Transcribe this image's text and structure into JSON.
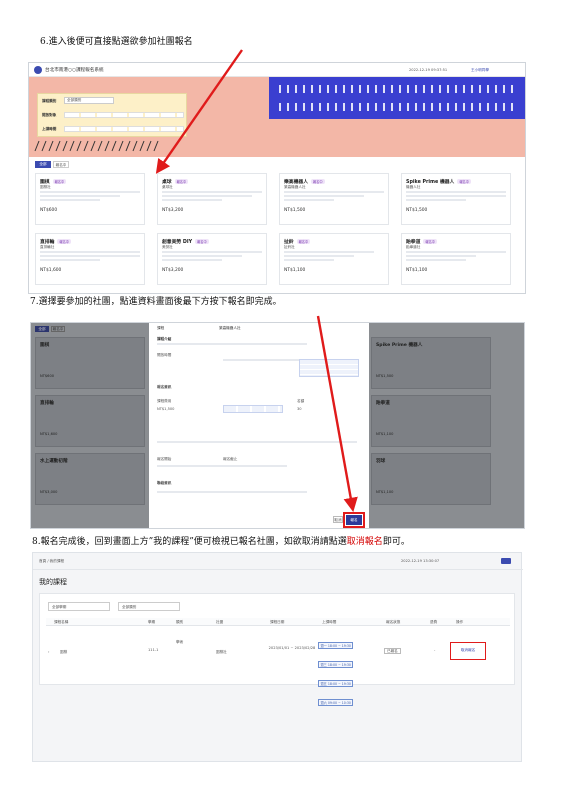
{
  "steps": {
    "step6": "6.進入後便可直接點選欲參加社團報名",
    "step7": "7.選擇要參加的社團，點進資料畫面後最下方按下報名即完成。",
    "step8_prefix": "8.報名完成後，回到畫面上方”我的課程”便可檢視已報名社團，如欲取消請點選",
    "step8_red": "取消報名",
    "step8_suffix": "即可。"
  },
  "shot1": {
    "site_title": "台北市南港○○課程報名系統",
    "date": "2022-12-19 09:37:51",
    "user": "王小明同學",
    "filter_labels": [
      "課程類別",
      "開放對象",
      "上課時間"
    ],
    "filter_select": "全部類別",
    "tab_all": "全部",
    "tab_open": "報名中",
    "cards": [
      {
        "title": "圍棋",
        "badge": "報名中",
        "sub": "圍棋社",
        "price": "NT$600"
      },
      {
        "title": "桌球",
        "badge": "報名中",
        "sub": "桌球社",
        "price": "NT$3,200"
      },
      {
        "title": "樂高機器人",
        "badge": "報名中",
        "sub": "樂高機器人社",
        "price": "NT$1,500"
      },
      {
        "title": "Spike Prime 機器人",
        "badge": "報名中",
        "sub": "機器人社",
        "price": "NT$1,500"
      },
      {
        "title": "直排輪",
        "badge": "報名中",
        "sub": "直排輪社",
        "price": "NT$1,600"
      },
      {
        "title": "創意美勞 DIY",
        "badge": "報名中",
        "sub": "美勞社",
        "price": "NT$3,200"
      },
      {
        "title": "扯鈴",
        "badge": "報名中",
        "sub": "扯鈴社",
        "price": "NT$1,100"
      },
      {
        "title": "跆拳道",
        "badge": "報名中",
        "sub": "跆拳道社",
        "price": "NT$1,100"
      }
    ]
  },
  "shot2": {
    "tab_all": "全部",
    "tab_open": "報名中",
    "left_cards": [
      {
        "title": "圍棋",
        "price": "NT$600"
      },
      {
        "title": "直排輪",
        "price": "NT$1,600"
      },
      {
        "title": "水上運動初階",
        "price": "NT$3,000"
      }
    ],
    "right_cards": [
      {
        "title": "Spike Prime 機器人",
        "price": "NT$1,500"
      },
      {
        "title": "跆拳道",
        "price": "NT$1,100"
      },
      {
        "title": "羽球",
        "price": "NT$1,100"
      }
    ],
    "modal": {
      "course_label": "課程",
      "course_value": "樂高機器人社",
      "section_info": "課程介紹",
      "label_time": "開放時間",
      "label_fee": "課程費用",
      "fee_value": "NT$1,500",
      "label_seats": "名額",
      "seats_value": "30",
      "section_register": "報名資訊",
      "label_start": "報名開始",
      "label_end": "報名截止",
      "section_contact": "聯絡資訊",
      "cancel_button": "取消",
      "register_button": "報名"
    }
  },
  "shot3": {
    "breadcrumb": "首頁 / 我的課程",
    "date": "2022-12-19 13:30:07",
    "page_title": "我的課程",
    "select1": "全部學期",
    "select2": "全部類別",
    "headers": [
      "課程名稱",
      "學期",
      "類別",
      "社團",
      "課程日期",
      "上課時間",
      "報名狀態",
      "退費",
      "操作"
    ],
    "row": {
      "name": "圍棋",
      "term": "111-1",
      "category": "學術",
      "club": "圍棋社",
      "date": "2023/01/01 ~ 2023/02/28",
      "times": [
        "週一 18:00 ~ 19:30",
        "週三 18:00 ~ 19:30",
        "週五 18:00 ~ 19:30",
        "週六 09:00 ~ 10:30"
      ],
      "status": "已報名",
      "refund": "-",
      "action": "取消報名"
    }
  },
  "colors": {
    "highlight": "#e01b1b",
    "accent": "#3b4bb0",
    "banner": "#f2b7a6"
  }
}
